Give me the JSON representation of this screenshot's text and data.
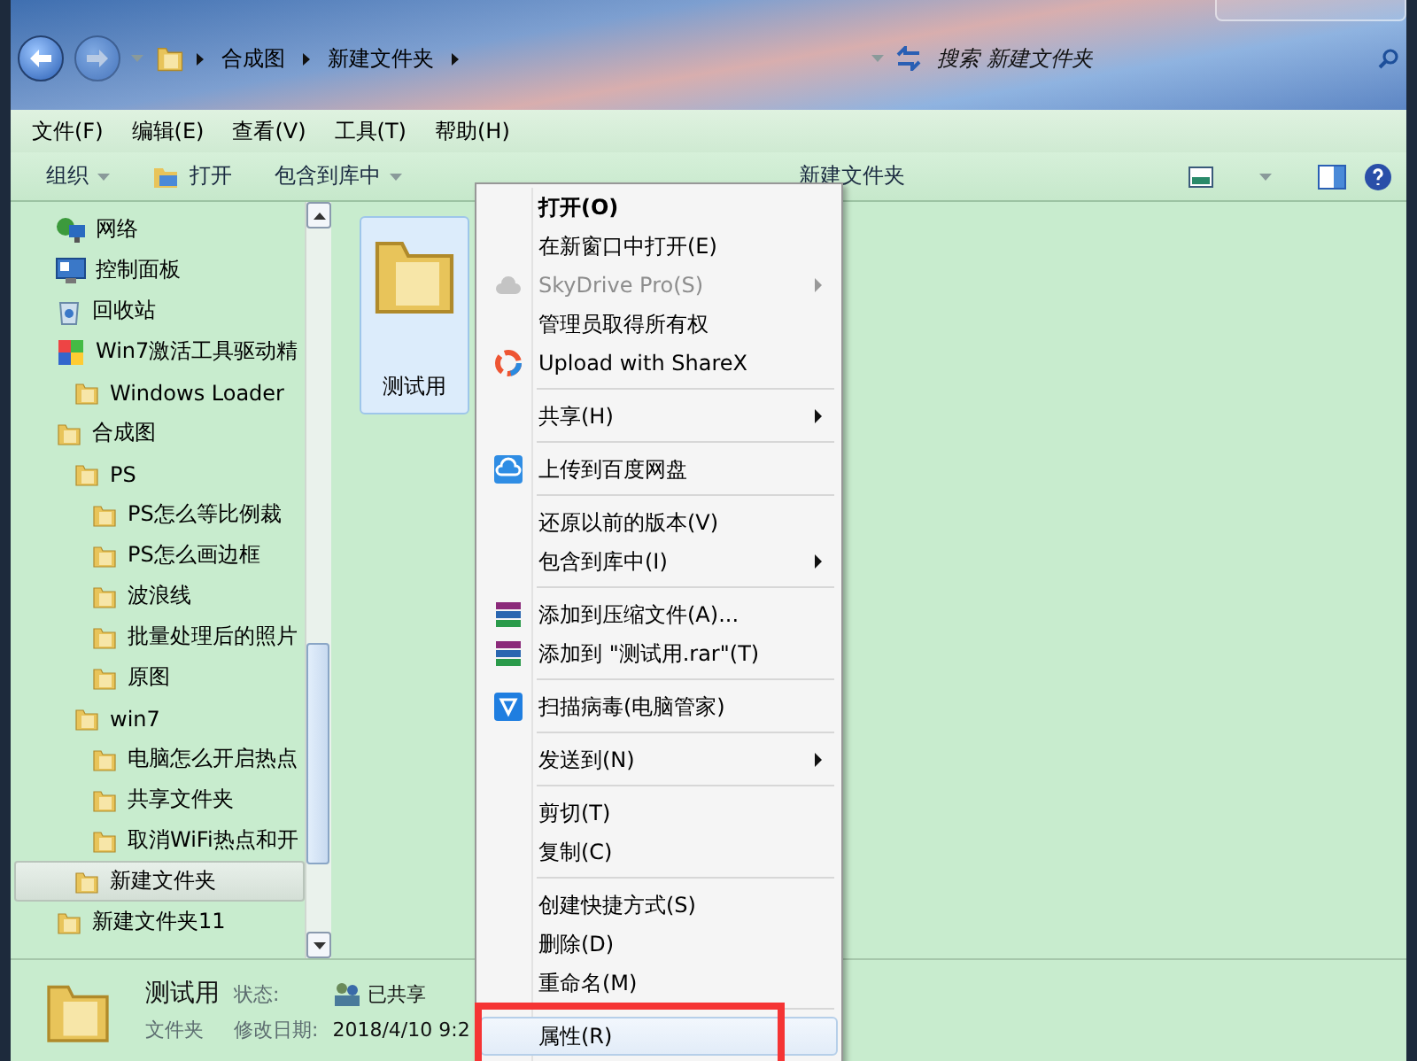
{
  "address_bar": {
    "breadcrumbs": [
      "合成图",
      "新建文件夹"
    ],
    "search": {
      "placeholder": "搜索 新建文件夹"
    }
  },
  "menu_bar": [
    "文件(F)",
    "编辑(E)",
    "查看(V)",
    "工具(T)",
    "帮助(H)"
  ],
  "toolbar": [
    {
      "label": "组织",
      "kind": "plain",
      "dropdown": true
    },
    {
      "label": "打开",
      "kind": "open",
      "dropdown": false
    },
    {
      "label": "包含到库中",
      "kind": "plain",
      "dropdown": true
    },
    {
      "label": "新建文件夹",
      "kind": "plain",
      "dropdown": false
    }
  ],
  "nav_tree": [
    {
      "label": "网络",
      "kind": "network",
      "selected": false
    },
    {
      "label": "控制面板",
      "kind": "control-panel",
      "selected": false
    },
    {
      "label": "回收站",
      "kind": "recycle",
      "selected": false
    },
    {
      "label": "Win7激活工具驱动精",
      "kind": "app",
      "selected": false,
      "children": [
        {
          "label": "Windows Loader",
          "kind": "folder",
          "selected": false
        }
      ]
    },
    {
      "label": "合成图",
      "kind": "folder",
      "selected": false,
      "children": [
        {
          "label": "PS",
          "kind": "folder",
          "selected": false,
          "children": [
            {
              "label": "PS怎么等比例裁",
              "kind": "folder",
              "selected": false
            },
            {
              "label": "PS怎么画边框",
              "kind": "folder",
              "selected": false
            },
            {
              "label": "波浪线",
              "kind": "folder",
              "selected": false
            },
            {
              "label": "批量处理后的照片",
              "kind": "folder",
              "selected": false
            },
            {
              "label": "原图",
              "kind": "folder",
              "selected": false
            }
          ]
        },
        {
          "label": "win7",
          "kind": "folder",
          "selected": false,
          "children": [
            {
              "label": "电脑怎么开启热点",
              "kind": "folder",
              "selected": false
            },
            {
              "label": "共享文件夹",
              "kind": "folder",
              "selected": false
            },
            {
              "label": "取消WiFi热点和开",
              "kind": "folder",
              "selected": false
            }
          ]
        },
        {
          "label": "新建文件夹",
          "kind": "folder",
          "selected": true
        }
      ]
    },
    {
      "label": "新建文件夹11",
      "kind": "folder",
      "selected": false
    }
  ],
  "files": [
    {
      "name": "测试用",
      "selected": true
    }
  ],
  "details": {
    "name": "测试用",
    "type": "文件夹",
    "status_label": "状态:",
    "status": "已共享",
    "date_label": "修改日期:",
    "date": "2018/4/10 9:2"
  },
  "context_menu": [
    [
      {
        "label": "打开(O)",
        "kind": "plain",
        "bold": true,
        "disabled": false,
        "submenu": false,
        "selected": false,
        "annotated": false
      },
      {
        "label": "在新窗口中打开(E)",
        "kind": "plain",
        "bold": false,
        "disabled": false,
        "submenu": false,
        "selected": false,
        "annotated": false
      },
      {
        "label": "SkyDrive Pro(S)",
        "kind": "cloud",
        "bold": false,
        "disabled": true,
        "submenu": true,
        "selected": false,
        "annotated": false
      },
      {
        "label": "管理员取得所有权",
        "kind": "plain",
        "bold": false,
        "disabled": false,
        "submenu": false,
        "selected": false,
        "annotated": false
      },
      {
        "label": "Upload with ShareX",
        "kind": "ring",
        "bold": false,
        "disabled": false,
        "submenu": false,
        "selected": false,
        "annotated": false
      }
    ],
    [
      {
        "label": "共享(H)",
        "kind": "plain",
        "bold": false,
        "disabled": false,
        "submenu": true,
        "selected": false,
        "annotated": false
      }
    ],
    [
      {
        "label": "上传到百度网盘",
        "kind": "cloud-badge",
        "bold": false,
        "disabled": false,
        "submenu": false,
        "selected": false,
        "annotated": false
      }
    ],
    [
      {
        "label": "还原以前的版本(V)",
        "kind": "plain",
        "bold": false,
        "disabled": false,
        "submenu": false,
        "selected": false,
        "annotated": false
      },
      {
        "label": "包含到库中(I)",
        "kind": "plain",
        "bold": false,
        "disabled": false,
        "submenu": true,
        "selected": false,
        "annotated": false
      }
    ],
    [
      {
        "label": "添加到压缩文件(A)...",
        "kind": "books",
        "bold": false,
        "disabled": false,
        "submenu": false,
        "selected": false,
        "annotated": false
      },
      {
        "label": "添加到 \"测试用.rar\"(T)",
        "kind": "books",
        "bold": false,
        "disabled": false,
        "submenu": false,
        "selected": false,
        "annotated": false
      }
    ],
    [
      {
        "label": "扫描病毒(电脑管家)",
        "kind": "shield",
        "bold": false,
        "disabled": false,
        "submenu": false,
        "selected": false,
        "annotated": false
      }
    ],
    [
      {
        "label": "发送到(N)",
        "kind": "plain",
        "bold": false,
        "disabled": false,
        "submenu": true,
        "selected": false,
        "annotated": false
      }
    ],
    [
      {
        "label": "剪切(T)",
        "kind": "plain",
        "bold": false,
        "disabled": false,
        "submenu": false,
        "selected": false,
        "annotated": false
      },
      {
        "label": "复制(C)",
        "kind": "plain",
        "bold": false,
        "disabled": false,
        "submenu": false,
        "selected": false,
        "annotated": false
      }
    ],
    [
      {
        "label": "创建快捷方式(S)",
        "kind": "plain",
        "bold": false,
        "disabled": false,
        "submenu": false,
        "selected": false,
        "annotated": false
      },
      {
        "label": "删除(D)",
        "kind": "plain",
        "bold": false,
        "disabled": false,
        "submenu": false,
        "selected": false,
        "annotated": false
      },
      {
        "label": "重命名(M)",
        "kind": "plain",
        "bold": false,
        "disabled": false,
        "submenu": false,
        "selected": false,
        "annotated": false
      }
    ],
    [
      {
        "label": "属性(R)",
        "kind": "plain",
        "bold": false,
        "disabled": false,
        "submenu": false,
        "selected": true,
        "annotated": true
      }
    ]
  ]
}
